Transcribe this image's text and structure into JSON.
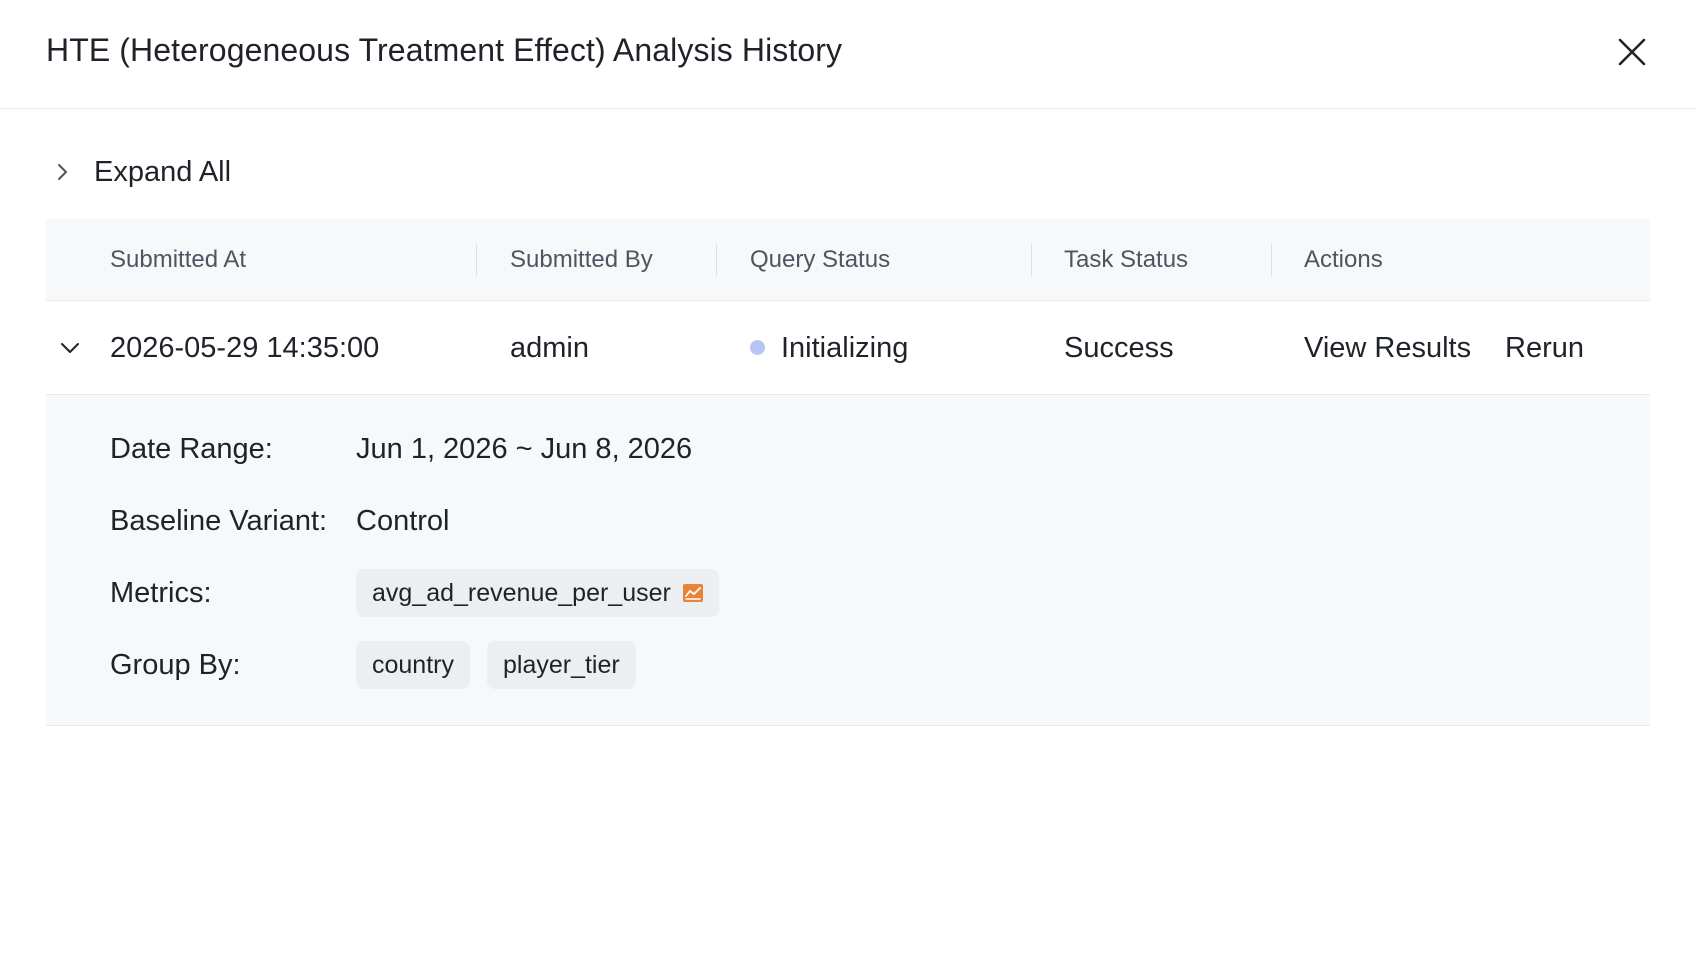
{
  "dialog": {
    "title": "HTE (Heterogeneous Treatment Effect) Analysis History",
    "close_icon": "close-icon"
  },
  "toolbar": {
    "expand_all_label": "Expand All",
    "expand_icon": "chevron-right-icon"
  },
  "table": {
    "columns": [
      "Submitted At",
      "Submitted By",
      "Query Status",
      "Task Status",
      "Actions"
    ],
    "rows": [
      {
        "submitted_at": "2026-05-29 14:35:00",
        "submitted_by": "admin",
        "query_status": "Initializing",
        "task_status": "Success",
        "actions": [
          "View Results",
          "Rerun"
        ],
        "expanded": true,
        "details": {
          "date_range_label": "Date Range:",
          "date_range": "Jun 1, 2026 ~ Jun 8, 2026",
          "baseline_label": "Baseline Variant:",
          "baseline": "Control",
          "metrics_label": "Metrics:",
          "metrics": [
            "avg_ad_revenue_per_user"
          ],
          "group_by_label": "Group By:",
          "group_by": [
            "country",
            "player_tier"
          ]
        }
      }
    ]
  },
  "colors": {
    "link": "#3367e0",
    "status_dot": "#b5c6f5",
    "metric_icon": "#e8843a",
    "header_bg": "#f7f8fa",
    "details_bg": "#f7f8fc"
  }
}
